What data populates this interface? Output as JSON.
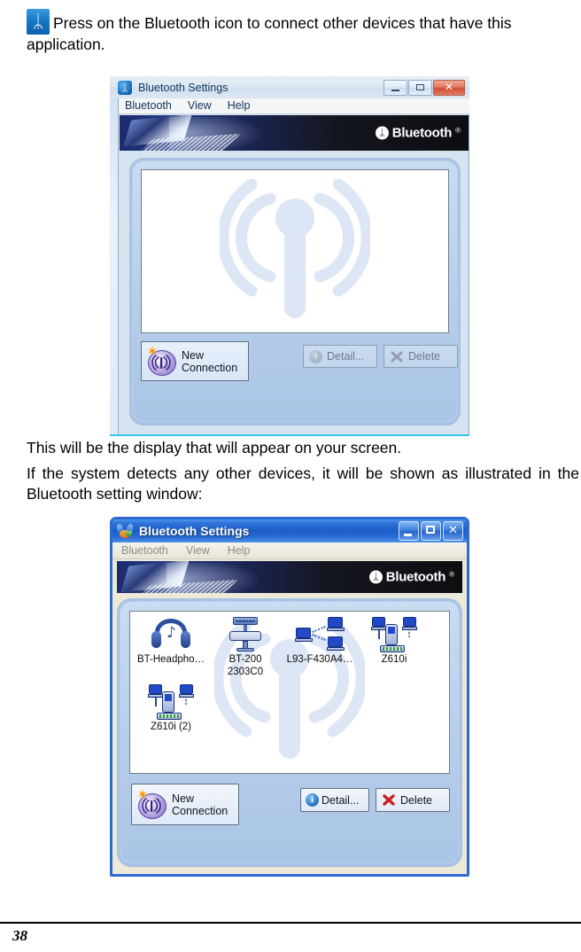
{
  "document": {
    "page_number": "38",
    "paragraphs": {
      "intro": "Press on the Bluetooth icon to connect other devices that have this application.",
      "after_first_window": "This will be the display that will appear on your screen.",
      "before_second_window": "If the system detects any other devices, it will be shown as illustrated in the Bluetooth setting window:"
    },
    "inline_icon": {
      "name": "bluetooth-icon",
      "glyph": "ᛦ",
      "color": "#1478c8"
    }
  },
  "window_empty": {
    "title": "Bluetooth Settings",
    "title_icon": "bluetooth-icon",
    "caption_buttons": {
      "minimize": "Minimize",
      "maximize": "Maximize",
      "close": "Close"
    },
    "menu": [
      "Bluetooth",
      "View",
      "Help"
    ],
    "banner": {
      "brand": "Bluetooth",
      "registered_mark": "®",
      "mark_glyph": "ᛦ"
    },
    "device_list": {
      "devices": [],
      "watermark": "bluetooth-antenna-watermark"
    },
    "buttons": {
      "new_connection": {
        "label": "New\nConnection",
        "enabled": true,
        "icon": "new-connection-icon"
      },
      "detail": {
        "label": "Detail...",
        "enabled": false,
        "icon": "info-icon"
      },
      "delete": {
        "label": "Delete",
        "enabled": false,
        "icon": "x-mark-icon"
      }
    }
  },
  "window_devices": {
    "title": "Bluetooth Settings",
    "title_icon": "bluetooth-settings-icon",
    "caption_buttons": {
      "minimize": "Minimize",
      "maximize": "Maximize",
      "close": "Close"
    },
    "menu": [
      "Bluetooth",
      "View",
      "Help"
    ],
    "banner": {
      "brand": "Bluetooth",
      "registered_mark": "®",
      "mark_glyph": "ᛦ"
    },
    "device_list": {
      "watermark": "bluetooth-antenna-watermark",
      "devices": [
        {
          "name": "BT-Headpho…",
          "icon": "headphones-icon",
          "type": "headset"
        },
        {
          "name": "BT-200\n2303C0",
          "icon": "printer-icon",
          "type": "printer"
        },
        {
          "name": "L93-F430A4…",
          "icon": "network-computers-icon",
          "type": "computer"
        },
        {
          "name": "Z610i",
          "icon": "phone-icon",
          "type": "phone"
        },
        {
          "name": "Z610i (2)",
          "icon": "phone-icon",
          "type": "phone"
        }
      ]
    },
    "buttons": {
      "new_connection": {
        "label": "New\nConnection",
        "enabled": true,
        "icon": "new-connection-icon"
      },
      "detail": {
        "label": "Detail...",
        "enabled": true,
        "icon": "info-icon"
      },
      "delete": {
        "label": "Delete",
        "enabled": true,
        "icon": "x-mark-icon"
      }
    }
  }
}
